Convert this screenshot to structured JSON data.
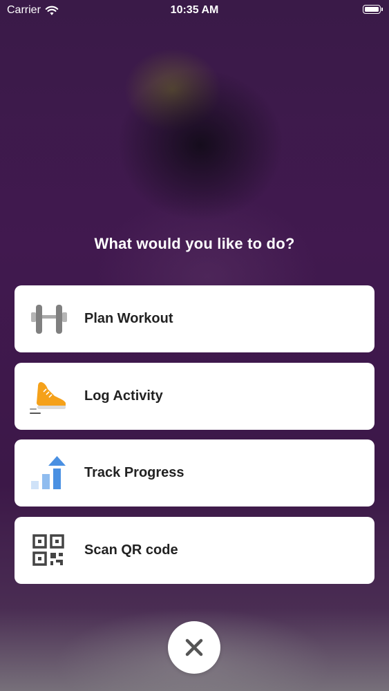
{
  "status_bar": {
    "carrier": "Carrier",
    "time": "10:35 AM",
    "icons": [
      "wifi-icon",
      "battery-icon"
    ]
  },
  "prompt": "What would you like to do?",
  "options": [
    {
      "label": "Plan Workout",
      "icon": "dumbbell-icon"
    },
    {
      "label": "Log Activity",
      "icon": "running-shoe-icon"
    },
    {
      "label": "Track Progress",
      "icon": "progress-chart-icon"
    },
    {
      "label": "Scan QR code",
      "icon": "qr-code-icon"
    }
  ],
  "close": {
    "icon": "close-icon"
  },
  "colors": {
    "background": "#3e1a4c",
    "card": "#ffffff",
    "text_primary": "#222222",
    "shoe_orange": "#f5a11a",
    "progress_blue": "#4a90e2",
    "close_x": "#555555"
  }
}
